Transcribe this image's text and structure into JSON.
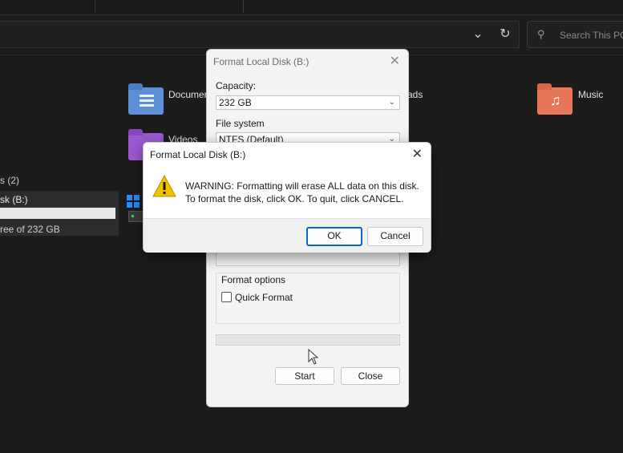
{
  "explorer": {
    "search_placeholder": "Search This PC",
    "folders": [
      {
        "label": "Documents",
        "icon": "documents-folder-icon",
        "color": "#5b8fd6"
      },
      {
        "label": "Music",
        "icon": "music-folder-icon",
        "color": "#e8765a"
      },
      {
        "label": "Videos",
        "icon": "videos-folder-icon",
        "color": "#9b59d0"
      },
      {
        "label": "ads",
        "icon": "downloads-folder-icon",
        "color": "#3fa0d8"
      }
    ],
    "devices_header": "s (2)",
    "drive": {
      "name": "sk (B:)",
      "free": "ree of 232 GB",
      "usage_fraction": 0.0
    }
  },
  "format_dialog": {
    "title": "Format Local Disk (B:)",
    "capacity_label": "Capacity:",
    "capacity_value": "232 GB",
    "filesystem_label": "File system",
    "filesystem_value": "NTFS (Default)",
    "format_options_label": "Format options",
    "quick_format_label": "Quick Format",
    "quick_format_checked": false,
    "start_label": "Start",
    "close_label": "Close"
  },
  "warning_dialog": {
    "title": "Format Local Disk (B:)",
    "line1": "WARNING: Formatting will erase ALL data on this disk.",
    "line2": "To format the disk, click OK. To quit, click CANCEL.",
    "ok_label": "OK",
    "cancel_label": "Cancel",
    "icon": "warning-icon",
    "icon_color": "#f2c200"
  }
}
